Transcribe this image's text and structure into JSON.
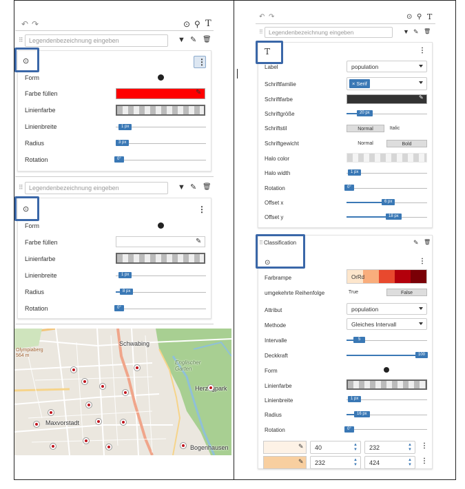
{
  "left_toolbar": {
    "undo": "↶",
    "redo": "↷",
    "text_tool": "T"
  },
  "layer1": {
    "legend_placeholder": "Legendenbezeichnung eingeben",
    "form_label": "Form",
    "fill_label": "Farbe füllen",
    "fill_color": "#ff0000",
    "stroke_label": "Linienfarbe",
    "width_label": "Linienbreite",
    "width_value": "1 px",
    "radius_label": "Radius",
    "radius_value": "3 px",
    "rotation_label": "Rotation",
    "rotation_value": "0°"
  },
  "layer2": {
    "legend_placeholder": "Legendenbezeichnung eingeben",
    "form_label": "Form",
    "fill_label": "Farbe füllen",
    "stroke_label": "Linienfarbe",
    "width_label": "Linienbreite",
    "width_value": "1 px",
    "radius_label": "Radius",
    "radius_value": "8 px",
    "rotation_label": "Rotation",
    "rotation_value": "0°"
  },
  "map": {
    "labels": [
      "Schwabing",
      "Englischer Garten",
      "Herzogpark",
      "Maxvorstadt",
      "Bogenhausen",
      "Olympiaberg 564 m"
    ]
  },
  "text_panel": {
    "legend_placeholder": "Legendenbezeichnung eingeben",
    "label_label": "Label",
    "label_value": "population",
    "font_family_label": "Schriftfamilie",
    "font_family_value": "Serif",
    "font_color_label": "Schriftfarbe",
    "font_color": "#333333",
    "font_size_label": "Schriftgröße",
    "font_size_value": "20 px",
    "font_style_label": "Schriftstil",
    "font_style_normal": "Normal",
    "font_style_italic": "Italic",
    "font_weight_label": "Schriftgewicht",
    "font_weight_normal": "Normal",
    "font_weight_bold": "Bold",
    "halo_color_label": "Halo color",
    "halo_width_label": "Halo width",
    "halo_width_value": "1 px",
    "rotation_label": "Rotation",
    "rotation_value": "0°",
    "offset_x_label": "Offset x",
    "offset_x_value": "6 px",
    "offset_y_label": "Offset y",
    "offset_y_value": "18 px"
  },
  "classification": {
    "title": "Classification",
    "ramp_label": "Farbrampe",
    "ramp_name": "OrRd",
    "ramp_colors": [
      "#fde6cc",
      "#f9ad7c",
      "#e8492e",
      "#b3000b",
      "#7a0006"
    ],
    "reverse_label": "umgekehrte Reihenfolge",
    "reverse_true": "True",
    "reverse_false": "False",
    "attribute_label": "Attribut",
    "attribute_value": "population",
    "method_label": "Methode",
    "method_value": "Gleiches Intervall",
    "intervals_label": "Intervalle",
    "intervals_value": "5",
    "opacity_label": "Deckkraft",
    "opacity_value": "100",
    "form_label": "Form",
    "stroke_label": "Linienfarbe",
    "width_label": "Linienbreite",
    "width_value": "1 px",
    "radius_label": "Radius",
    "radius_value": "16 px",
    "rotation_label": "Rotation",
    "rotation_value": "0°",
    "rows": [
      {
        "color": "#fdf2e6",
        "from": "40",
        "to": "232"
      },
      {
        "color": "#f8cfa0",
        "from": "232",
        "to": "424"
      }
    ]
  }
}
